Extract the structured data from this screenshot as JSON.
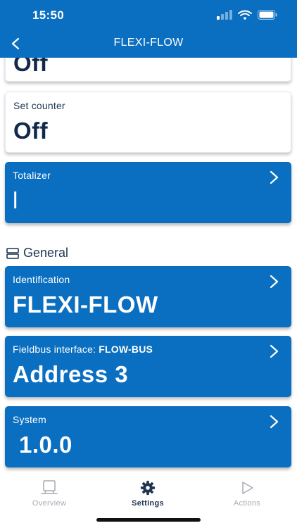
{
  "status_bar": {
    "time": "15:50"
  },
  "nav": {
    "title": "FLEXI-FLOW"
  },
  "cards": {
    "partial": {
      "value": "Off"
    },
    "set_counter": {
      "label": "Set counter",
      "value": "Off"
    },
    "totalizer": {
      "label": "Totalizer",
      "value": "l"
    },
    "identification": {
      "label": "Identification",
      "value": "FLEXI-FLOW"
    },
    "fieldbus": {
      "label": "Fieldbus interface:",
      "label_bold": "FLOW-BUS",
      "value": "Address 3"
    },
    "system": {
      "label": "System",
      "value": "1.0.0"
    }
  },
  "section": {
    "general": "General"
  },
  "tabs": [
    {
      "label": "Overview",
      "icon": "monitor-icon",
      "active": false
    },
    {
      "label": "Settings",
      "icon": "gear-icon",
      "active": true
    },
    {
      "label": "Actions",
      "icon": "play-icon",
      "active": false
    }
  ],
  "colors": {
    "brand_blue": "#0a6fc0",
    "dark_text": "#13294b",
    "inactive_tab": "#a7acb2"
  }
}
